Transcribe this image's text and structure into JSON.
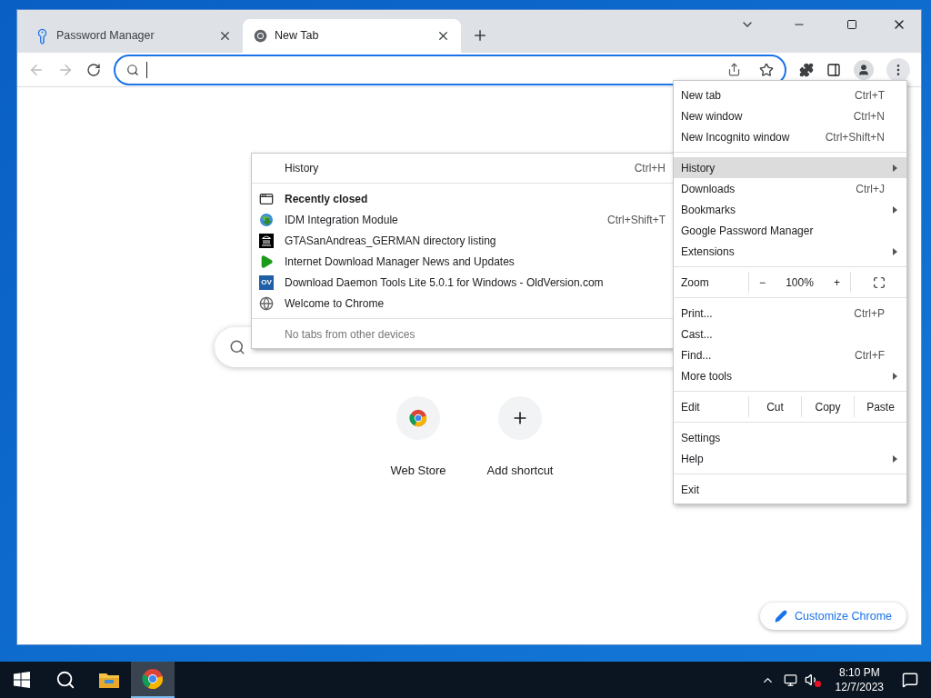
{
  "tabs": [
    {
      "title": "Password Manager",
      "kind": "key",
      "selected": false
    },
    {
      "title": "New Tab",
      "kind": "chrome",
      "selected": true
    }
  ],
  "new_tab_page": {
    "shortcuts": [
      {
        "label": "Web Store",
        "kind": "webstore"
      },
      {
        "label": "Add shortcut",
        "kind": "add"
      }
    ],
    "customize_button": "Customize Chrome"
  },
  "menu": [
    {
      "kind": "item",
      "label": "New tab",
      "shortcut": "Ctrl+T",
      "submenu": false,
      "selected": false
    },
    {
      "kind": "item",
      "label": "New window",
      "shortcut": "Ctrl+N",
      "submenu": false,
      "selected": false
    },
    {
      "kind": "item",
      "label": "New Incognito window",
      "shortcut": "Ctrl+Shift+N",
      "submenu": false,
      "selected": false
    },
    {
      "kind": "separator"
    },
    {
      "kind": "item",
      "label": "History",
      "submenu": true,
      "selected": true
    },
    {
      "kind": "item",
      "label": "Downloads",
      "shortcut": "Ctrl+J",
      "submenu": false,
      "selected": false
    },
    {
      "kind": "item",
      "label": "Bookmarks",
      "submenu": true,
      "selected": false
    },
    {
      "kind": "item",
      "label": "Google Password Manager",
      "submenu": false,
      "selected": false
    },
    {
      "kind": "item",
      "label": "Extensions",
      "submenu": true,
      "selected": false
    },
    {
      "kind": "separator"
    },
    {
      "kind": "zoom",
      "label": "Zoom",
      "minus": "−",
      "value": "100%",
      "plus": "+"
    },
    {
      "kind": "separator"
    },
    {
      "kind": "item",
      "label": "Print...",
      "shortcut": "Ctrl+P",
      "submenu": false,
      "selected": false
    },
    {
      "kind": "item",
      "label": "Cast...",
      "submenu": false,
      "selected": false
    },
    {
      "kind": "item",
      "label": "Find...",
      "shortcut": "Ctrl+F",
      "submenu": false,
      "selected": false
    },
    {
      "kind": "item",
      "label": "More tools",
      "submenu": true,
      "selected": false
    },
    {
      "kind": "separator"
    },
    {
      "kind": "edit",
      "label": "Edit",
      "buttons": [
        "Cut",
        "Copy",
        "Paste"
      ]
    },
    {
      "kind": "separator"
    },
    {
      "kind": "item",
      "label": "Settings",
      "submenu": false,
      "selected": false
    },
    {
      "kind": "item",
      "label": "Help",
      "submenu": true,
      "selected": false
    },
    {
      "kind": "separator"
    },
    {
      "kind": "item",
      "label": "Exit",
      "submenu": false,
      "selected": false
    }
  ],
  "history_menu": [
    {
      "kind": "item",
      "label": "History",
      "shortcut": "Ctrl+H"
    },
    {
      "kind": "separator"
    },
    {
      "kind": "header",
      "label": "Recently closed"
    },
    {
      "kind": "integration",
      "label": "IDM Integration Module",
      "shortcut": "Ctrl+Shift+T"
    },
    {
      "kind": "archive",
      "label": "GTASanAndreas_GERMAN directory listing"
    },
    {
      "kind": "download",
      "label": "Internet Download Manager News and Updates"
    },
    {
      "kind": "badge",
      "label": "Download Daemon Tools Lite 5.0.1 for Windows - OldVersion.com",
      "badge": "OV"
    },
    {
      "kind": "globe",
      "label": "Welcome to Chrome"
    },
    {
      "kind": "separator"
    },
    {
      "kind": "note",
      "label": "No tabs from other devices"
    }
  ],
  "taskbar": {
    "apps": [
      {
        "kind": "start",
        "selected": false
      },
      {
        "kind": "search",
        "selected": false
      },
      {
        "kind": "folder",
        "selected": false
      },
      {
        "kind": "chrome",
        "selected": true
      }
    ],
    "time": "8:10 PM",
    "date": "12/7/2023"
  }
}
